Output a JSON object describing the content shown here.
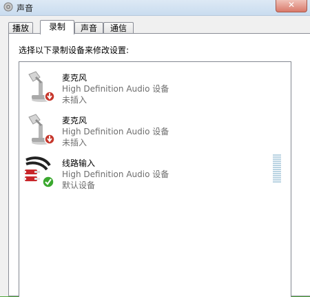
{
  "window": {
    "title": "声音",
    "close_label": "✕"
  },
  "tabs": [
    {
      "label": "播放",
      "active": false
    },
    {
      "label": "录制",
      "active": true
    },
    {
      "label": "声音",
      "active": false
    },
    {
      "label": "通信",
      "active": false
    }
  ],
  "panel": {
    "instructions": "选择以下录制设备来修改设置:"
  },
  "devices": [
    {
      "name": "麦克风",
      "description": "High Definition Audio 设备",
      "status": "未插入",
      "icon": "microphone-icon",
      "badge": "unplugged-badge-icon"
    },
    {
      "name": "麦克风",
      "description": "High Definition Audio 设备",
      "status": "未插入",
      "icon": "microphone-icon",
      "badge": "unplugged-badge-icon"
    },
    {
      "name": "线路输入",
      "description": "High Definition Audio 设备",
      "status": "默认设备",
      "icon": "line-in-cable-icon",
      "badge": "default-check-icon",
      "level": 0
    }
  ],
  "colors": {
    "unplugged_badge": "#c6372c",
    "default_badge": "#3aa82e",
    "level_meter": "#b9d3e2"
  }
}
